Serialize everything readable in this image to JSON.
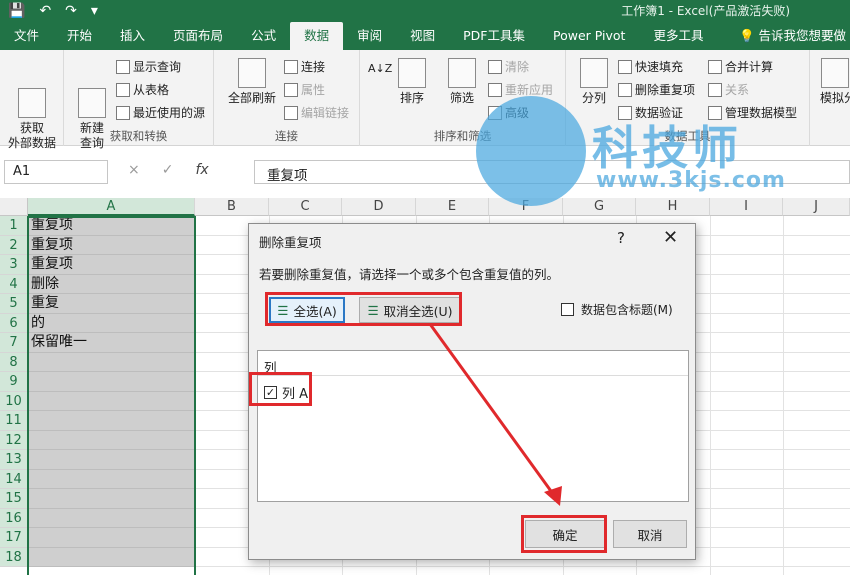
{
  "titlebar": {
    "title": "工作簿1 - Excel(产品激活失败)",
    "qat_icons": [
      "save-icon",
      "undo-icon",
      "redo-icon",
      "customize-icon"
    ]
  },
  "tabs": [
    "文件",
    "开始",
    "插入",
    "页面布局",
    "公式",
    "数据",
    "审阅",
    "视图",
    "PDF工具集",
    "Power Pivot",
    "更多工具"
  ],
  "active_tab": "数据",
  "tell_me": "告诉我您想要做",
  "ribbon": {
    "get_external": "获取\n外部数据",
    "new_query": "新建\n查询",
    "show_query": "显示查询",
    "from_table": "从表格",
    "recent_sources": "最近使用的源",
    "group_get_transform": "获取和转换",
    "refresh_all": "全部刷新",
    "connections": "连接",
    "properties": "属性",
    "edit_links": "编辑链接",
    "group_connections": "连接",
    "sort_az": "A↓Z",
    "sort": "排序",
    "filter": "筛选",
    "clear": "清除",
    "reapply": "重新应用",
    "advanced": "高级",
    "group_sort_filter": "排序和筛选",
    "text_to_columns": "分列",
    "flash_fill": "快速填充",
    "remove_duplicates": "删除重复项",
    "data_validation": "数据验证",
    "consolidate": "合并计算",
    "relationships": "关系",
    "manage_data_model": "管理数据模型",
    "group_data_tools": "数据工具",
    "what_if": "模拟分"
  },
  "formula_bar": {
    "name_box": "A1",
    "cancel": "×",
    "enter": "✓",
    "fx": "fx",
    "content": "重复项"
  },
  "columns": [
    "A",
    "B",
    "C",
    "D",
    "E",
    "F",
    "G",
    "H",
    "I",
    "J"
  ],
  "rows": [
    "1",
    "2",
    "3",
    "4",
    "5",
    "6",
    "7",
    "8",
    "9",
    "10",
    "11",
    "12",
    "13",
    "14",
    "15",
    "16",
    "17",
    "18"
  ],
  "cells_A": [
    "重复项",
    "重复项",
    "重复项",
    "删除",
    "重复",
    "的",
    "保留唯一",
    "",
    "",
    "",
    "",
    "",
    "",
    "",
    "",
    "",
    "",
    ""
  ],
  "watermark": {
    "text": "科技师",
    "url": "www.3kjs.com"
  },
  "dialog": {
    "title": "删除重复项",
    "help": "?",
    "close": "✕",
    "info": "若要删除重复值，请选择一个或多个包含重复值的列。",
    "select_all": "全选(A)",
    "unselect_all": "取消全选(U)",
    "has_headers": "数据包含标题(M)",
    "list_header": "列",
    "list_item": "列 A",
    "list_item_checked": true,
    "ok": "确定",
    "cancel": "取消"
  },
  "accent": "#217346",
  "annotation_color": "#e0292c"
}
